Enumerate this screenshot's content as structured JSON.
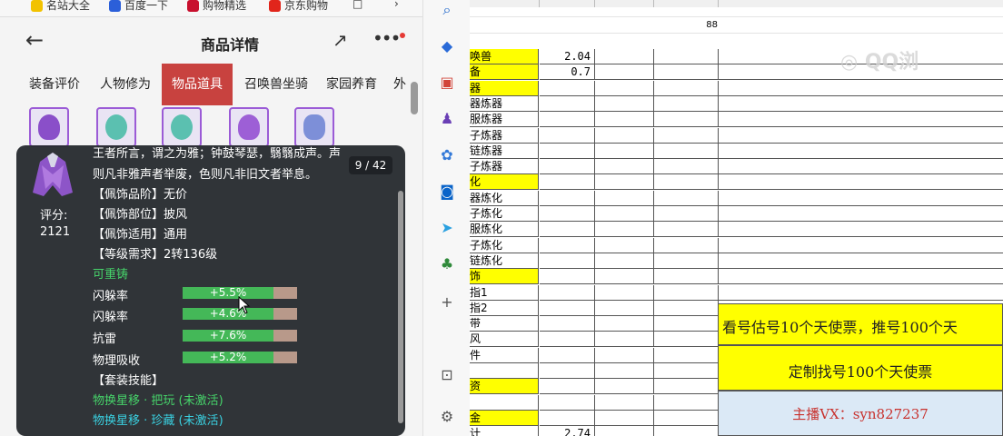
{
  "bookmarks": [
    "名站大全",
    "百度一下",
    "购物精选",
    "京东购物"
  ],
  "nav": {
    "back": "←",
    "title": "商品详情",
    "share": "↗",
    "more": "•••"
  },
  "tabs": [
    "装备评价",
    "人物修为",
    "物品道具",
    "召唤兽坐骑",
    "家园养育",
    "外"
  ],
  "tooltip": {
    "page": "9 / 42",
    "score_label": "评分:",
    "score_value": "2121",
    "desc1": "王者所言，谓之为雅；钟鼓琴瑟，翳翳成声。声",
    "desc2": "则凡非雅声者举废，色则凡非旧文者举息。",
    "grade": "【佩饰品阶】无价",
    "part": "【佩饰部位】披风",
    "fit": "【佩饰适用】通用",
    "level": "【等级需求】2转136级",
    "recast": "可重铸",
    "stats": [
      {
        "label": "闪躲率",
        "value": "+5.5%",
        "fill": 0.79
      },
      {
        "label": "闪躲率",
        "value": "+4.6%",
        "fill": 0.79
      },
      {
        "label": "抗雷",
        "value": "+7.6%",
        "fill": 0.79
      },
      {
        "label": "物理吸收",
        "value": "+5.2%",
        "fill": 0.79
      }
    ],
    "suit": "【套装技能】",
    "skill1": "物换星移 · 把玩 (未激活)",
    "skill2": "物换星移 · 珍藏 (未激活)"
  },
  "sidebar_icons": [
    "search-icon",
    "tag-icon",
    "toolbox-icon",
    "people-icon",
    "copilot-icon",
    "outlook-icon",
    "send-icon",
    "tree-icon",
    "plus-icon",
    "screenshot-icon",
    "settings-icon"
  ],
  "sheet": {
    "header_note": "88",
    "rows": [
      {
        "label": "唤兽",
        "yellow": true,
        "value": "2.04"
      },
      {
        "label": "备",
        "yellow": true,
        "value": "0.7"
      },
      {
        "label": "器",
        "yellow": true,
        "value": ""
      },
      {
        "label": "器炼器",
        "yellow": false,
        "value": ""
      },
      {
        "label": "服炼器",
        "yellow": false,
        "value": ""
      },
      {
        "label": "子炼器",
        "yellow": false,
        "value": ""
      },
      {
        "label": "链炼器",
        "yellow": false,
        "value": ""
      },
      {
        "label": "子炼器",
        "yellow": false,
        "value": ""
      },
      {
        "label": "化",
        "yellow": true,
        "value": ""
      },
      {
        "label": "器炼化",
        "yellow": false,
        "value": ""
      },
      {
        "label": "子炼化",
        "yellow": false,
        "value": ""
      },
      {
        "label": "服炼化",
        "yellow": false,
        "value": ""
      },
      {
        "label": "子炼化",
        "yellow": false,
        "value": ""
      },
      {
        "label": "链炼化",
        "yellow": false,
        "value": ""
      },
      {
        "label": "饰",
        "yellow": true,
        "value": ""
      },
      {
        "label": "指1",
        "yellow": false,
        "value": ""
      },
      {
        "label": "指2",
        "yellow": false,
        "value": ""
      },
      {
        "label": "带",
        "yellow": false,
        "value": ""
      },
      {
        "label": "风",
        "yellow": false,
        "value": ""
      },
      {
        "label": "件",
        "yellow": false,
        "value": ""
      },
      {
        "label": "",
        "yellow": false,
        "value": ""
      },
      {
        "label": "资",
        "yellow": true,
        "value": ""
      },
      {
        "label": "",
        "yellow": false,
        "value": ""
      },
      {
        "label": "金",
        "yellow": true,
        "value": ""
      },
      {
        "label": "计",
        "yellow": false,
        "value": "2.74"
      }
    ],
    "promo1": "看号估号10个天使票，推号100个天",
    "promo2": "定制找号100个天使票",
    "promo3": "主播VX：syn827237",
    "watermark": "QQ浏"
  }
}
